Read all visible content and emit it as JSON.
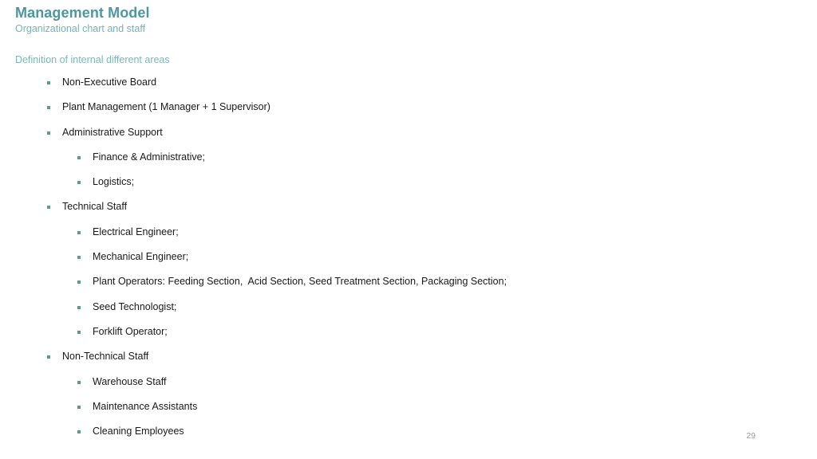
{
  "slide": {
    "title": "Management Model",
    "subtitle": "Organizational chart and staff",
    "section_heading": "Definition of internal different areas",
    "page_number": "29",
    "colors": {
      "title": "#4E96A0",
      "subtitle": "#79B2B4",
      "section_heading": "#7FB7B8",
      "bullet_marker": "#5C9E84",
      "body_text": "#1a1a1a",
      "page_number": "#9a9a9a",
      "background": "#ffffff"
    },
    "bullets": [
      {
        "level": 1,
        "text": "Non-Executive Board"
      },
      {
        "level": 1,
        "text": "Plant Management (1 Manager + 1 Supervisor)"
      },
      {
        "level": 1,
        "text": "Administrative Support"
      },
      {
        "level": 2,
        "text": "Finance & Administrative;"
      },
      {
        "level": 2,
        "text": "Logistics;"
      },
      {
        "level": 1,
        "text": "Technical Staff"
      },
      {
        "level": 2,
        "text": "Electrical Engineer;"
      },
      {
        "level": 2,
        "text": "Mechanical Engineer;"
      },
      {
        "level": 2,
        "text": "Plant Operators: Feeding Section,  Acid Section, Seed Treatment Section, Packaging Section;"
      },
      {
        "level": 2,
        "text": "Seed Technologist;"
      },
      {
        "level": 2,
        "text": "Forklift Operator;"
      },
      {
        "level": 1,
        "text": "Non-Technical Staff"
      },
      {
        "level": 2,
        "text": "Warehouse Staff"
      },
      {
        "level": 2,
        "text": "Maintenance Assistants"
      },
      {
        "level": 2,
        "text": "Cleaning Employees"
      }
    ]
  }
}
